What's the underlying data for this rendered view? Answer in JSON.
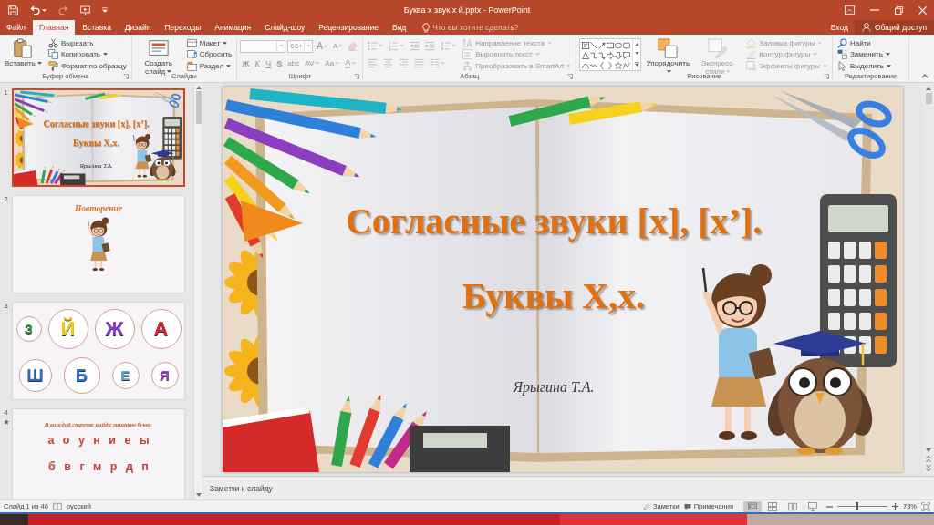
{
  "window": {
    "title": "Буква х звук х й.pptx - PowerPoint"
  },
  "quick_access": [
    {
      "kind": "save",
      "disabled": false
    },
    {
      "kind": "undo",
      "disabled": false
    },
    {
      "kind": "redo",
      "disabled": true
    },
    {
      "kind": "start",
      "disabled": false
    },
    {
      "kind": "customize",
      "disabled": false
    }
  ],
  "tabs": [
    {
      "label": "Файл",
      "selected": false
    },
    {
      "label": "Главная",
      "selected": true
    },
    {
      "label": "Вставка",
      "selected": false
    },
    {
      "label": "Дизайн",
      "selected": false
    },
    {
      "label": "Переходы",
      "selected": false
    },
    {
      "label": "Анимация",
      "selected": false
    },
    {
      "label": "Слайд-шоу",
      "selected": false
    },
    {
      "label": "Рецензирование",
      "selected": false
    },
    {
      "label": "Вид",
      "selected": false
    }
  ],
  "tell_me": {
    "placeholder": "Что вы хотите сделать?"
  },
  "account": {
    "sign_in": "Вход",
    "share": "Общий доступ"
  },
  "ribbon": {
    "groups": [
      {
        "label": "Буфер обмена",
        "launcher": true,
        "columns": [
          [
            {
              "kind": "large",
              "label": "Вставить",
              "dropdown": true,
              "disabled": false
            }
          ],
          [
            {
              "kind": "small",
              "label": "Вырезать",
              "disabled": false
            },
            {
              "kind": "small",
              "label": "Копировать",
              "dropdown": true,
              "disabled": false
            },
            {
              "kind": "small",
              "label": "Формат по образцу",
              "disabled": false
            }
          ]
        ]
      },
      {
        "label": "Слайды",
        "launcher": false,
        "columns": [
          [
            {
              "kind": "large",
              "label": "Создать слайд",
              "dropdown": true,
              "disabled": false
            }
          ],
          [
            {
              "kind": "small",
              "label": "Макет",
              "dropdown": true,
              "disabled": false
            },
            {
              "kind": "small",
              "label": "Сбросить",
              "disabled": false
            },
            {
              "kind": "small",
              "label": "Раздел",
              "dropdown": true,
              "disabled": false
            }
          ]
        ]
      },
      {
        "label": "Шрифт",
        "launcher": true,
        "columns": [
          [
            {
              "kind": "toolbar",
              "items": [
                {
                  "kind": "field",
                  "dropdown": true,
                  "disabled": true
                },
                {
                  "kind": "field",
                  "value": "66+",
                  "dropdown": true,
                  "disabled": true
                },
                {
                  "kind": "glyph",
                  "label": "A",
                  "disabled": true
                },
                {
                  "kind": "glyph",
                  "label": "A",
                  "disabled": true
                },
                {
                  "kind": "icon",
                  "disabled": true
                }
              ]
            },
            {
              "kind": "toolbar",
              "items": [
                {
                  "kind": "glyph",
                  "label": "Ж",
                  "disabled": true
                },
                {
                  "kind": "glyph",
                  "label": "К",
                  "disabled": true
                },
                {
                  "kind": "glyph",
                  "label": "Ч",
                  "disabled": true
                },
                {
                  "kind": "glyph",
                  "label": "S",
                  "disabled": true
                },
                {
                  "kind": "glyph",
                  "label": "abc",
                  "disabled": true
                },
                {
                  "kind": "glyph",
                  "label": "AV",
                  "dropdown": true,
                  "disabled": true
                },
                {
                  "kind": "glyph",
                  "label": "Aa",
                  "dropdown": true,
                  "disabled": true
                },
                {
                  "kind": "glyph",
                  "label": "A",
                  "dropdown": true,
                  "disabled": true
                }
              ]
            }
          ]
        ]
      },
      {
        "label": "Абзац",
        "launcher": true,
        "columns": [
          [
            {
              "kind": "toolbar",
              "items": [
                {
                  "kind": "icon",
                  "dropdown": true,
                  "disabled": true
                },
                {
                  "kind": "icon",
                  "dropdown": true,
                  "disabled": true
                },
                {
                  "kind": "icon",
                  "disabled": true
                },
                {
                  "kind": "icon",
                  "disabled": true
                },
                {
                  "kind": "icon",
                  "dropdown": true,
                  "disabled": true
                }
              ]
            },
            {
              "kind": "toolbar",
              "items": [
                {
                  "kind": "icon",
                  "disabled": true
                },
                {
                  "kind": "icon",
                  "disabled": true
                },
                {
                  "kind": "icon",
                  "disabled": true
                },
                {
                  "kind": "icon",
                  "disabled": true
                },
                {
                  "kind": "icon",
                  "dropdown": true,
                  "disabled": true
                }
              ]
            }
          ],
          [
            {
              "kind": "small",
              "label": "Направление текста",
              "dropdown": true,
              "disabled": true
            },
            {
              "kind": "small",
              "label": "Выровнять текст",
              "dropdown": true,
              "disabled": true
            },
            {
              "kind": "small",
              "label": "Преобразовать в SmartArt",
              "dropdown": true,
              "disabled": true
            }
          ]
        ]
      },
      {
        "label": "Рисование",
        "launcher": true,
        "columns": [
          [
            {
              "kind": "gallery"
            }
          ],
          [
            {
              "kind": "large",
              "label": "Упорядочить",
              "dropdown": true,
              "disabled": false
            }
          ],
          [
            {
              "kind": "large",
              "label": "Экспресс-стили",
              "dropdown": true,
              "disabled": true
            }
          ],
          [
            {
              "kind": "small",
              "label": "Заливка фигуры",
              "dropdown": true,
              "disabled": true
            },
            {
              "kind": "small",
              "label": "Контур фигуры",
              "dropdown": true,
              "disabled": true
            },
            {
              "kind": "small",
              "label": "Эффекты фигуры",
              "dropdown": true,
              "disabled": true
            }
          ]
        ]
      },
      {
        "label": "Редактирование",
        "launcher": false,
        "columns": [
          [
            {
              "kind": "small",
              "label": "Найти",
              "disabled": false
            },
            {
              "kind": "small",
              "label": "Заменить",
              "dropdown": true,
              "disabled": false
            },
            {
              "kind": "small",
              "label": "Выделить",
              "dropdown": true,
              "disabled": false
            }
          ]
        ]
      }
    ]
  },
  "slides": [
    {
      "number": "1",
      "selected": true,
      "animated": false,
      "kind": "title",
      "title": "Согласные звуки [х], [х’].",
      "subtitle": "Буквы Х,х.",
      "author": "Ярыгина Т.А."
    },
    {
      "number": "2",
      "selected": false,
      "animated": false,
      "kind": "heading",
      "title": "Повторение"
    },
    {
      "number": "3",
      "selected": false,
      "animated": false,
      "kind": "letters",
      "letters": [
        {
          "letter": "З",
          "color": "#2e9c3c"
        },
        {
          "letter": "Й",
          "color": "#f2cf1a"
        },
        {
          "letter": "Ж",
          "color": "#8e3fc0"
        },
        {
          "letter": "А",
          "color": "#d8262c"
        },
        {
          "letter": "Ш",
          "color": "#2a6fc0"
        },
        {
          "letter": "Б",
          "color": "#2f74d0"
        },
        {
          "letter": "Е",
          "color": "#58a8e0"
        },
        {
          "letter": "Я",
          "color": "#9b3cbf"
        }
      ]
    },
    {
      "number": "4",
      "selected": false,
      "animated": true,
      "kind": "exercise",
      "title": "В каждой строчке найди лишнюю букву.",
      "rows": [
        "а о у н и е ы",
        "б в г м р д п"
      ]
    }
  ],
  "editor": {
    "title": "Согласные звуки [х], [х’].",
    "subtitle": "Буквы Х,х.",
    "author": "Ярыгина Т.А."
  },
  "notes": {
    "placeholder": "Заметки к слайду"
  },
  "status_bar": {
    "slide_info": "Слайд 1 из 46",
    "language": "русский",
    "notes": "Заметки",
    "comments": "Примечания",
    "views": [
      {
        "kind": "normal",
        "selected": true
      },
      {
        "kind": "sorter",
        "selected": false
      },
      {
        "kind": "reading",
        "selected": false
      },
      {
        "kind": "slideshow",
        "selected": false
      }
    ],
    "zoom": {
      "level": 0.4,
      "reading": "73%"
    }
  }
}
